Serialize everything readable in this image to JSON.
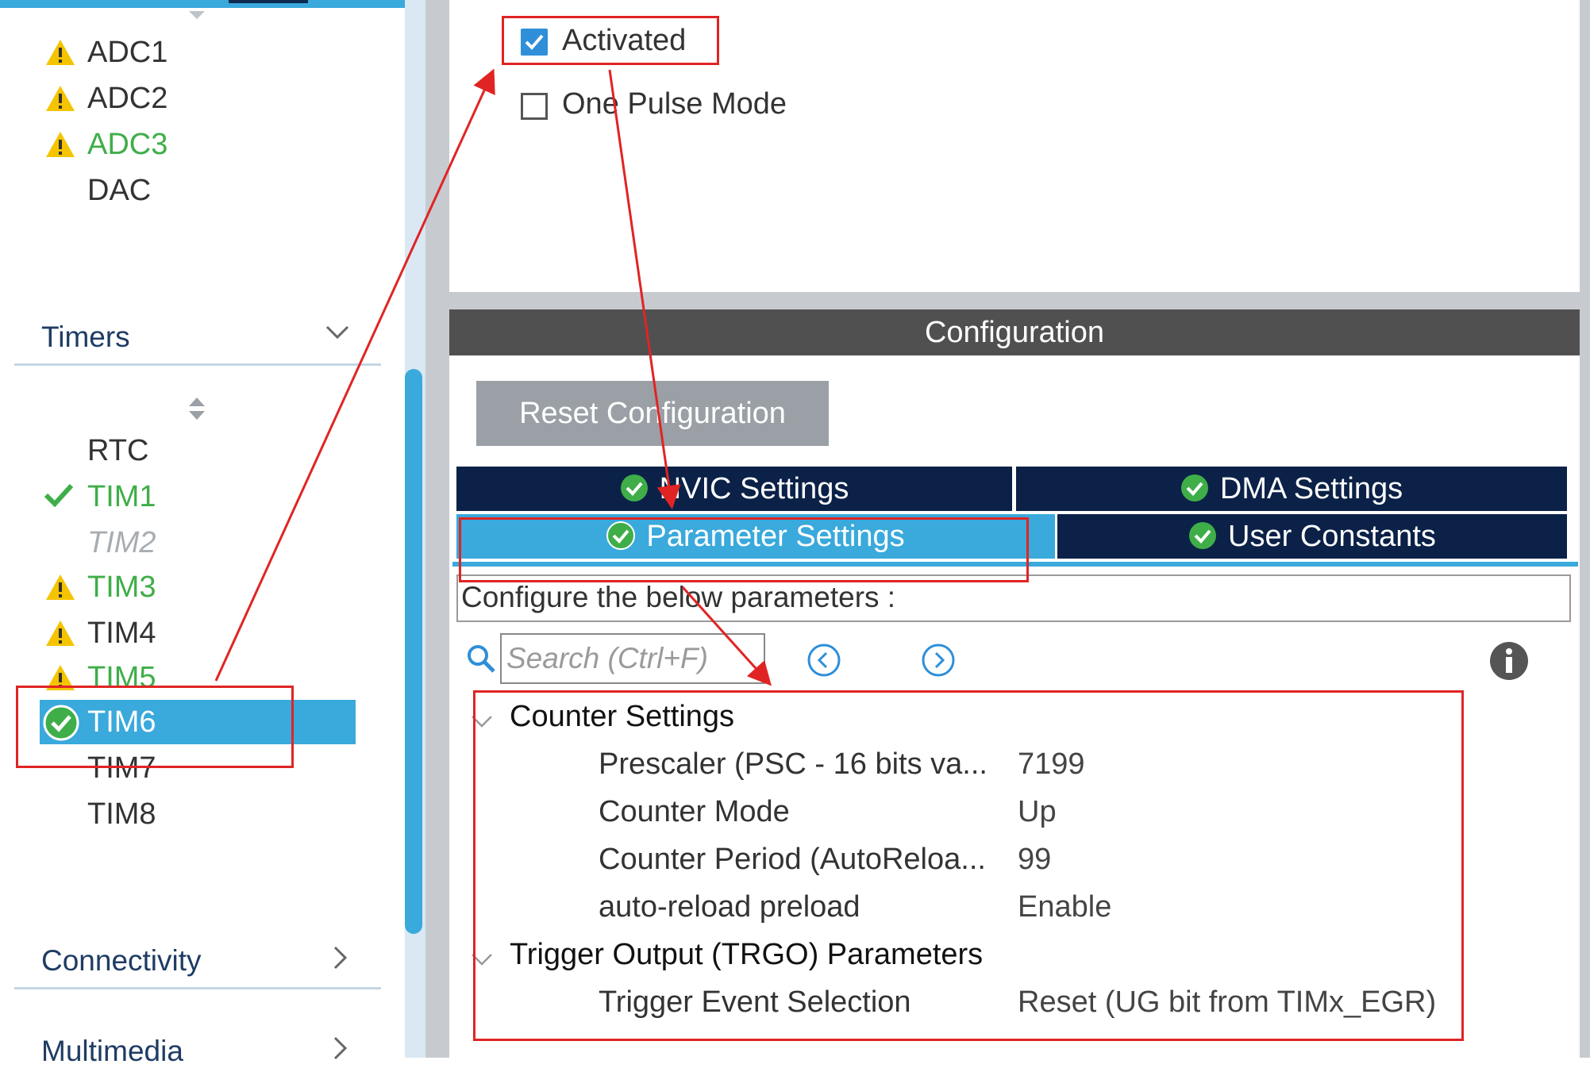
{
  "sidebar": {
    "analog_items": [
      {
        "label": "ADC1",
        "status": "warning"
      },
      {
        "label": "ADC2",
        "status": "warning"
      },
      {
        "label": "ADC3",
        "status": "warning-green"
      },
      {
        "label": "DAC",
        "status": "none"
      }
    ],
    "timers_title": "Timers",
    "timer_items": [
      {
        "label": "RTC",
        "status": "none"
      },
      {
        "label": "TIM1",
        "status": "ok"
      },
      {
        "label": "TIM2",
        "status": "disabled"
      },
      {
        "label": "TIM3",
        "status": "warning-green"
      },
      {
        "label": "TIM4",
        "status": "warning"
      },
      {
        "label": "TIM5",
        "status": "warning-green"
      },
      {
        "label": "TIM6",
        "status": "selected"
      },
      {
        "label": "TIM7",
        "status": "none"
      },
      {
        "label": "TIM8",
        "status": "none"
      }
    ],
    "connectivity_title": "Connectivity",
    "multimedia_title": "Multimedia"
  },
  "mode": {
    "activated_label": "Activated",
    "activated_checked": true,
    "one_pulse_label": "One Pulse Mode",
    "one_pulse_checked": false
  },
  "config": {
    "header": "Configuration",
    "reset_label": "Reset Configuration",
    "tabs": {
      "nvic": "NVIC Settings",
      "dma": "DMA Settings",
      "parameter": "Parameter Settings",
      "user_constants": "User Constants"
    },
    "description": "Configure the below parameters :",
    "search_placeholder": "Search (Ctrl+F)",
    "groups": [
      {
        "title": "Counter Settings",
        "params": [
          {
            "name": "Prescaler (PSC - 16 bits va...",
            "value": "7199"
          },
          {
            "name": "Counter Mode",
            "value": "Up"
          },
          {
            "name": "Counter Period (AutoReloa...",
            "value": "99"
          },
          {
            "name": "auto-reload preload",
            "value": "Enable"
          }
        ]
      },
      {
        "title": "Trigger Output (TRGO) Parameters",
        "params": [
          {
            "name": "Trigger Event Selection",
            "value": "Reset (UG bit from TIMx_EGR)"
          }
        ]
      }
    ]
  },
  "colors": {
    "accent_blue": "#3aa9dc",
    "tab_navy": "#0b2147",
    "ok_green": "#3fae49",
    "warning_yellow": "#f5c400",
    "annotation_red": "#e02424"
  }
}
